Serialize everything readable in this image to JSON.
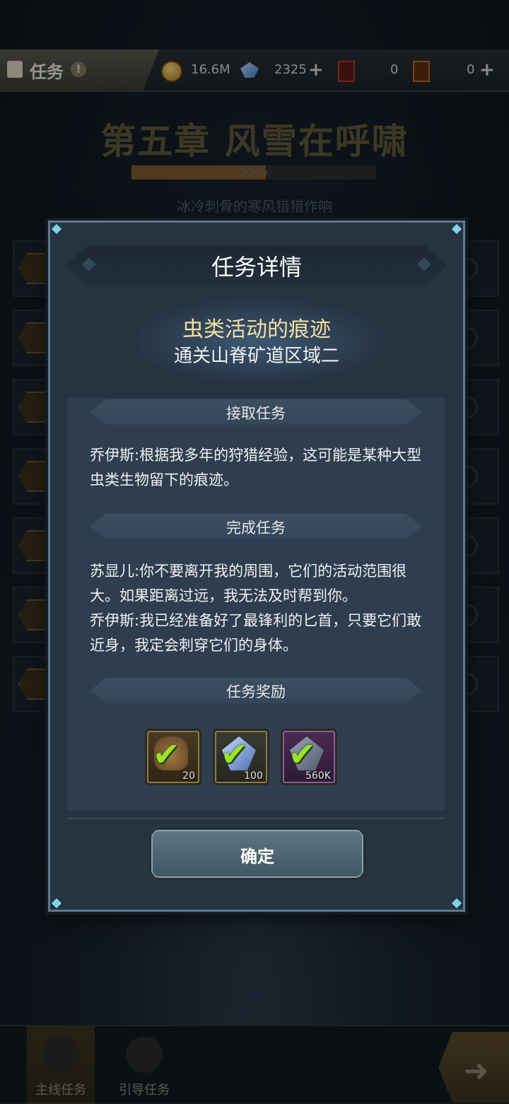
{
  "topbar": {
    "tab_label": "任务",
    "gold": "16.6M",
    "gems": "2325",
    "card_red": "0",
    "card_orange": "0"
  },
  "chapter": {
    "title": "第五章 风雪在呼啸",
    "progress": 0.55,
    "progress_label": "55%",
    "subtitle": "冰冷刺骨的寒风猎猎作响"
  },
  "modal": {
    "title": "任务详情",
    "quest_name": "虫类活动的痕迹",
    "quest_goal": "通关山脊矿道区域二",
    "accept_section": "接取任务",
    "accept_text": "乔伊斯:根据我多年的狩猎经验，这可能是某种大型虫类生物留下的痕迹。",
    "complete_section": "完成任务",
    "complete_text_1": "苏显儿:你不要离开我的周围，它们的活动范围很大。如果距离过远，我无法及时帮到你。",
    "complete_text_2": "乔伊斯:我已经准备好了最锋利的匕首，只要它们敢近身，我定会刺穿它们的身体。",
    "reward_section": "任务奖励",
    "rewards": [
      {
        "icon": "pot-icon",
        "qty": "20",
        "claimed": true
      },
      {
        "icon": "ore-icon",
        "qty": "100",
        "claimed": true
      },
      {
        "icon": "exp-gem-icon",
        "qty": "560K",
        "claimed": true
      }
    ],
    "confirm_label": "确定"
  },
  "bottom_nav": {
    "main_quest": "主线任务",
    "guide_quest": "引导任务"
  },
  "colors": {
    "quest_name": "#f5df9e",
    "check": "#9be42e",
    "modal_bg": "#263341"
  }
}
